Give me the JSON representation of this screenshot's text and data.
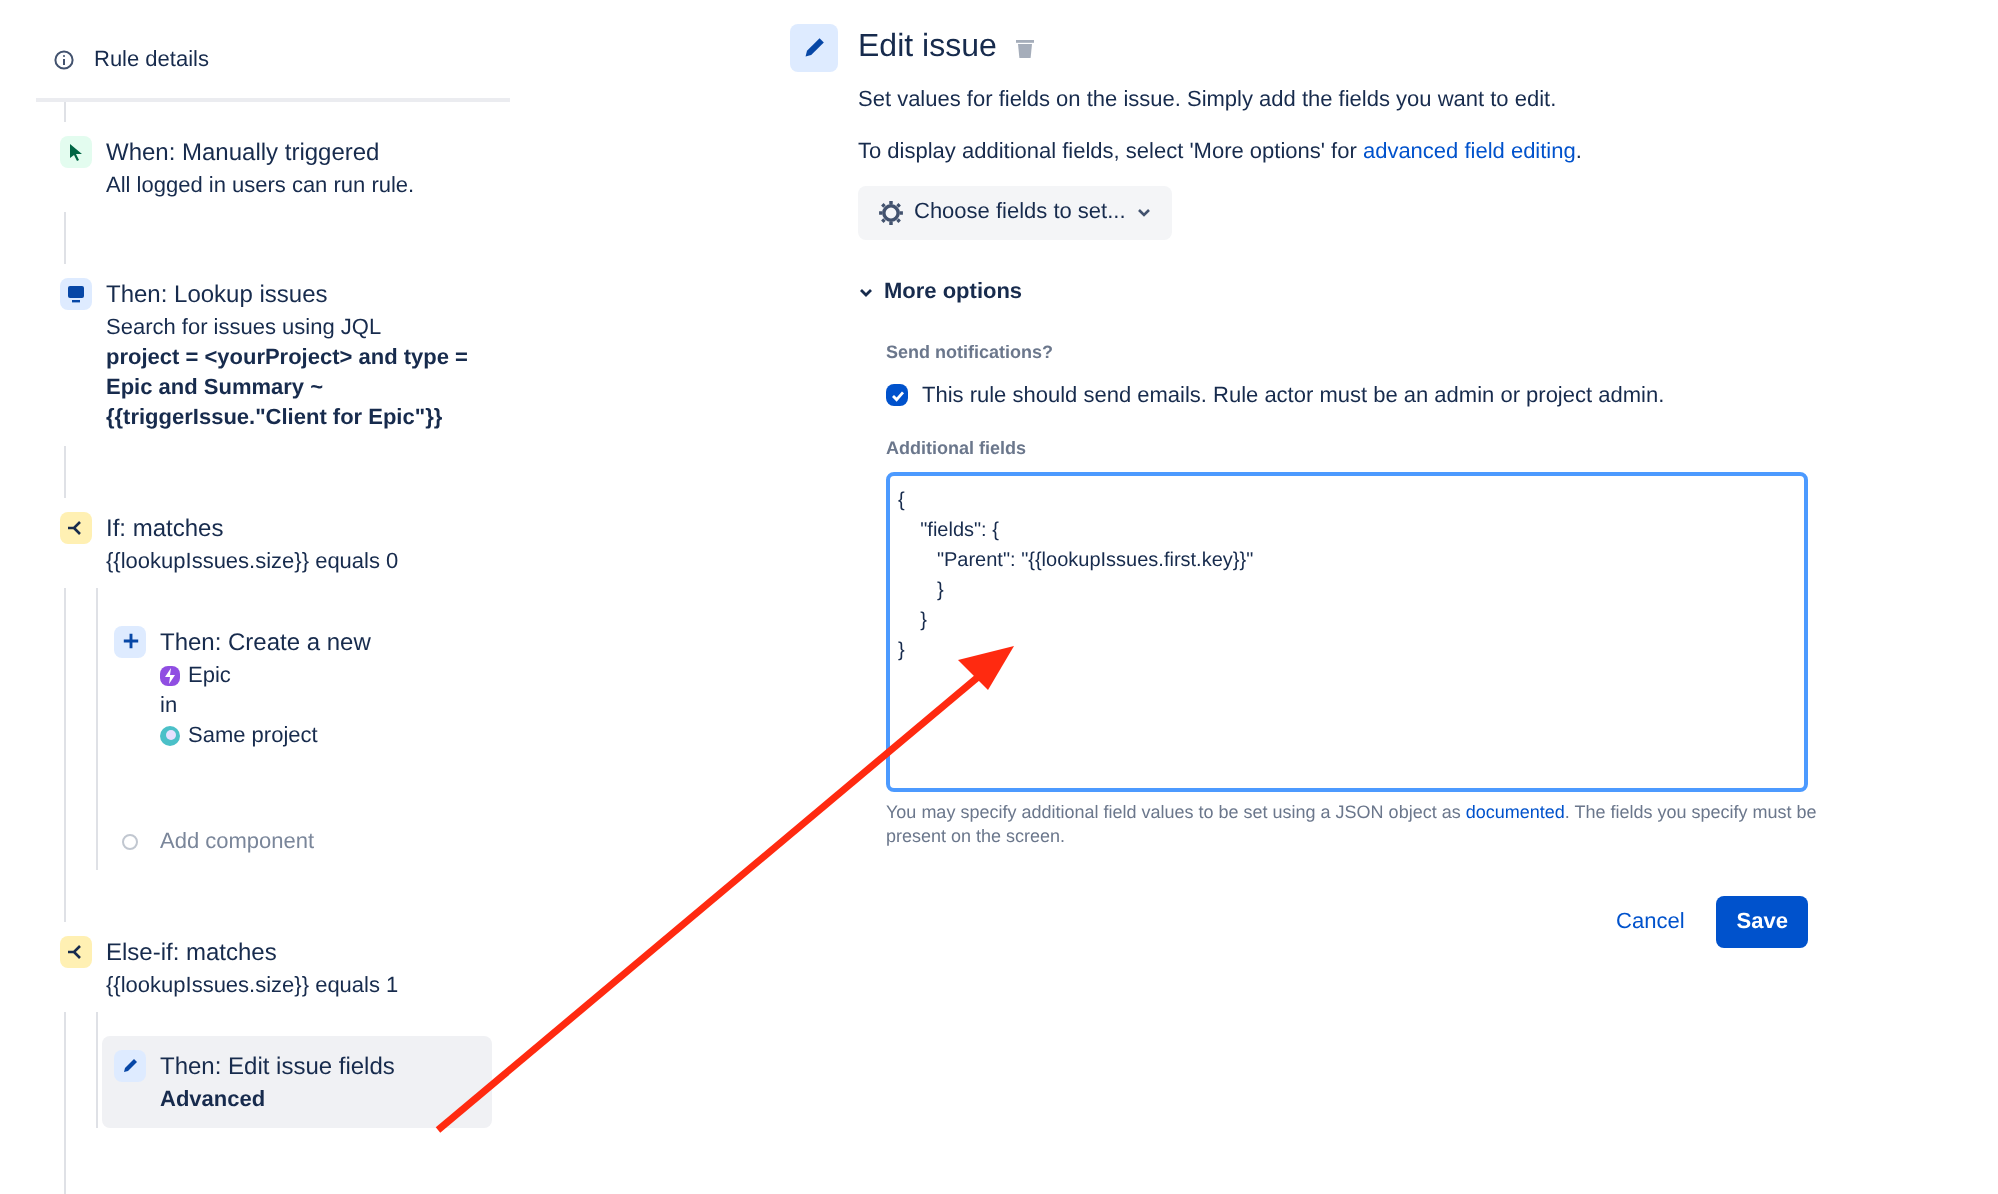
{
  "sidebar": {
    "rule_details": "Rule details",
    "components": [
      {
        "kind": "trigger",
        "selected": false,
        "title": "When: Manually triggered",
        "details": [
          {
            "kind": "plain",
            "text": "All logged in users can run rule."
          }
        ]
      },
      {
        "kind": "lookup",
        "selected": false,
        "title": "Then: Lookup issues",
        "details": [
          {
            "kind": "plain",
            "text": "Search for issues using JQL"
          },
          {
            "kind": "bold",
            "text": "project = <yourProject> and type = Epic and Summary ~ {{triggerIssue.\"Client for Epic\"}}"
          }
        ]
      },
      {
        "kind": "condition",
        "selected": false,
        "title": "If: matches",
        "details": [
          {
            "kind": "plain",
            "text": "{{lookupIssues.size}} equals 0"
          }
        ],
        "children": [
          {
            "kind": "create",
            "selected": false,
            "title": "Then: Create a new",
            "details": [
              {
                "kind": "epic",
                "text": "Epic"
              },
              {
                "kind": "plain",
                "text": "in"
              },
              {
                "kind": "project",
                "text": "Same project"
              }
            ]
          },
          {
            "kind": "add",
            "selected": false,
            "title": "Add component"
          }
        ]
      },
      {
        "kind": "condition",
        "selected": false,
        "title": "Else-if: matches",
        "details": [
          {
            "kind": "plain",
            "text": "{{lookupIssues.size}} equals 1"
          }
        ],
        "children": [
          {
            "kind": "edit",
            "selected": true,
            "title": "Then: Edit issue fields",
            "details": [
              {
                "kind": "bold",
                "text": "Advanced"
              }
            ]
          }
        ]
      }
    ]
  },
  "editor": {
    "title": "Edit issue",
    "intro": "Set values for fields on the issue. Simply add the fields you want to edit.",
    "hint": "To display additional fields, select 'More options' for",
    "hint_link": "advanced field editing",
    "hint_end": ".",
    "choose_button": "Choose fields to set...",
    "more_options": {
      "label": "More options",
      "expanded": true
    },
    "notifications": {
      "label": "Send notifications?",
      "checkbox": "This rule should send emails. Rule actor must be an admin or project admin.",
      "checked": true
    },
    "additional": {
      "label": "Additional fields",
      "value": "{\n    \"fields\": {\n       \"Parent\": \"{{lookupIssues.first.key}}\"\n       }\n    }\n}",
      "help": "You may specify additional field values to be set using a JSON object as",
      "help_link": "documented",
      "help_end": ". The fields you specify must be present on the screen."
    },
    "buttons": {
      "cancel": "Cancel",
      "save": "Save"
    }
  }
}
